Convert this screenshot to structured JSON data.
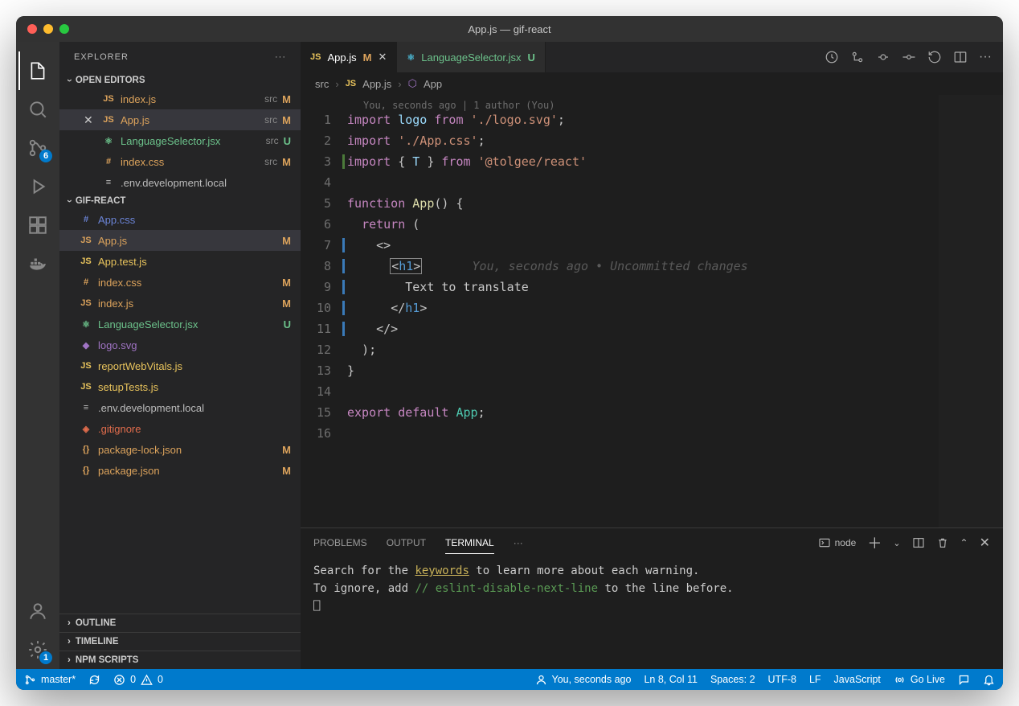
{
  "title": "App.js — gif-react",
  "explorer": {
    "label": "EXPLORER"
  },
  "sections": {
    "openEditors": "OPEN EDITORS",
    "project": "GIF-REACT",
    "outline": "OUTLINE",
    "timeline": "TIMELINE",
    "npm": "NPM SCRIPTS"
  },
  "openEditors": [
    {
      "icon": "JS",
      "name": "index.js",
      "dir": "src",
      "status": "M",
      "cls": "mod ic-js"
    },
    {
      "icon": "JS",
      "name": "App.js",
      "dir": "src",
      "status": "M",
      "cls": "mod ic-js",
      "active": true,
      "close": true
    },
    {
      "icon": "⚛",
      "name": "LanguageSelector.jsx",
      "dir": "src",
      "status": "U",
      "cls": "new-f ic-react"
    },
    {
      "icon": "#",
      "name": "index.css",
      "dir": "src",
      "status": "M",
      "cls": "mod ic-css"
    },
    {
      "icon": "≡",
      "name": ".env.development.local",
      "dir": "",
      "status": "",
      "cls": "ic-txt"
    }
  ],
  "tree": [
    {
      "icon": "#",
      "name": "App.css",
      "status": "",
      "cls": "ic-css"
    },
    {
      "icon": "JS",
      "name": "App.js",
      "status": "M",
      "cls": "mod ic-js",
      "active": true
    },
    {
      "icon": "JS",
      "name": "App.test.js",
      "status": "",
      "cls": "ic-js"
    },
    {
      "icon": "#",
      "name": "index.css",
      "status": "M",
      "cls": "mod ic-css"
    },
    {
      "icon": "JS",
      "name": "index.js",
      "status": "M",
      "cls": "mod ic-js"
    },
    {
      "icon": "⚛",
      "name": "LanguageSelector.jsx",
      "status": "U",
      "cls": "new-f ic-react"
    },
    {
      "icon": "◆",
      "name": "logo.svg",
      "status": "",
      "cls": "ic-svg"
    },
    {
      "icon": "JS",
      "name": "reportWebVitals.js",
      "status": "",
      "cls": "ic-js"
    },
    {
      "icon": "JS",
      "name": "setupTests.js",
      "status": "",
      "cls": "ic-js"
    },
    {
      "icon": "≡",
      "name": ".env.development.local",
      "status": "",
      "cls": "ic-txt"
    },
    {
      "icon": "◈",
      "name": ".gitignore",
      "status": "",
      "cls": "ic-git"
    },
    {
      "icon": "{}",
      "name": "package-lock.json",
      "status": "M",
      "cls": "mod ic-json"
    },
    {
      "icon": "{}",
      "name": "package.json",
      "status": "M",
      "cls": "mod ic-json"
    }
  ],
  "tabs": [
    {
      "icon": "JS",
      "name": "App.js",
      "status": "M",
      "active": true,
      "cls": "ic-js"
    },
    {
      "icon": "⚛",
      "name": "LanguageSelector.jsx",
      "status": "U",
      "active": false,
      "cls": "ic-react"
    }
  ],
  "breadcrumbs": {
    "a": "src",
    "b": "App.js",
    "c": "App"
  },
  "gitAnnotation": "You, seconds ago | 1 author (You)",
  "blame": "You, seconds ago • Uncommitted changes",
  "code": {
    "l1": {
      "kw": "import",
      "id": " logo ",
      "kw2": "from ",
      "str": "'./logo.svg'",
      "p": ";"
    },
    "l2": {
      "kw": "import ",
      "str": "'./App.css'",
      "p": ";"
    },
    "l3": {
      "kw": "import ",
      "p1": "{ ",
      "id": "T",
      "p2": " } ",
      "kw2": "from ",
      "str": "'@tolgee/react'"
    },
    "l5": {
      "kw": "function ",
      "fn": "App",
      "p": "() {"
    },
    "l6": {
      "kw": "return",
      "p": " ("
    },
    "l7": "<>",
    "l8a": "<",
    "l8b": "h1",
    "l8c": ">",
    "l9": "Text to translate",
    "l10": "</",
    "l10b": "h1",
    "l10c": ">",
    "l11": "</>",
    "l12": ");",
    "l13": "}",
    "l15": {
      "kw": "export ",
      "kw2": "default ",
      "id": "App",
      "p": ";"
    }
  },
  "panel": {
    "tabs": {
      "problems": "PROBLEMS",
      "output": "OUTPUT",
      "terminal": "TERMINAL"
    },
    "shell": "node",
    "line1a": "Search for the ",
    "line1b": "keywords",
    "line1c": " to learn more about each warning.",
    "line2a": "To ignore, add ",
    "line2b": "// eslint-disable-next-line",
    "line2c": " to the line before.",
    "prompt": "⎕"
  },
  "badges": {
    "scm": "6",
    "settings": "1"
  },
  "status": {
    "branch": "master*",
    "errors": "0",
    "warnings": "0",
    "blame": "You, seconds ago",
    "pos": "Ln 8, Col 11",
    "spaces": "Spaces: 2",
    "enc": "UTF-8",
    "eol": "LF",
    "lang": "JavaScript",
    "live": "Go Live"
  }
}
